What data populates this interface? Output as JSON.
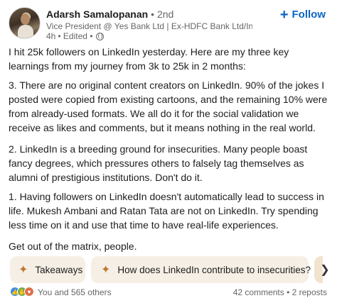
{
  "author": {
    "name": "Adarsh Samalopanan",
    "degree": "• 2nd",
    "headline": "Vice President @ Yes Bank Ltd | Ex-HDFC Bank Ltd/Ind...",
    "time": "4h",
    "edited": "• Edited •",
    "visibility_icon": "globe-icon"
  },
  "follow_button": {
    "plus": "+",
    "label": "Follow"
  },
  "post": {
    "paragraphs": [
      "I hit 25k followers on LinkedIn yesterday. Here are my three key learnings from my journey from 3k to 25k in 2 months:",
      "3. There are no original content creators on LinkedIn. 90% of the jokes I posted were copied from existing cartoons, and the remaining 10% were from already-used formats. We all do it for the social validation we receive as likes and comments, but it means nothing in the real world.",
      "2. LinkedIn is a breeding ground for insecurities. Many people boast fancy degrees, which pressures others to falsely tag themselves as alumni of prestigious institutions. Don't do it.",
      "1. Having followers on LinkedIn doesn't automatically lead to success in life. Mukesh Ambani and Ratan Tata are not on LinkedIn. Try spending less time on it and use that time to have real-life experiences.",
      "Get out of the matrix, people."
    ]
  },
  "suggestions": [
    {
      "icon": "sparkle-icon",
      "label": "Takeaways"
    },
    {
      "icon": "sparkle-icon",
      "label": "How does LinkedIn contribute to insecurities?"
    }
  ],
  "scroll_right_icon": "chevron-right-icon",
  "social": {
    "reactions": [
      "like-icon",
      "celebrate-icon",
      "love-icon"
    ],
    "reaction_count": "You and 565 others",
    "comments_reposts": "42 comments • 2 reposts"
  },
  "colors": {
    "accent": "#0a66c2",
    "chip_bg": "#f6efe6",
    "sparkle": "#c0772b",
    "secondary_text": "#666666"
  }
}
